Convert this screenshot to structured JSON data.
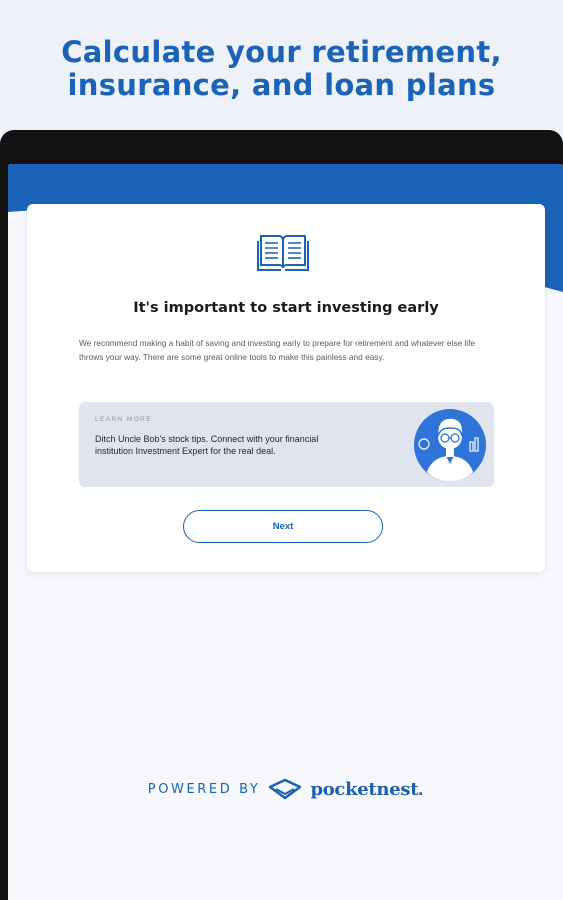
{
  "headline": {
    "line1": "Calculate your retirement,",
    "line2": "insurance, and loan plans"
  },
  "card": {
    "icon": "open-book-icon",
    "title": "It's important to start investing early",
    "body": "We recommend making a habit of saving and investing early to prepare for retirement and whatever else life throws your way.  There are some great online tools to make this painless and easy.",
    "learn_more": {
      "label": "LEARN MORE",
      "text": "Ditch Uncle Bob's stock tips. Connect with your financial institution Investment Expert for the real deal.",
      "illustration": "investment-expert-avatar"
    },
    "next_label": "Next"
  },
  "footer": {
    "powered_by": "POWERED BY",
    "brand": "pocketnest",
    "brand_dot": ".",
    "brand_icon": "pocketnest-logo-icon"
  },
  "colors": {
    "brand_blue": "#1a63b8",
    "page_bg": "#eef1f7",
    "device_frame": "#121212",
    "learn_box_bg": "#dfe4ee"
  }
}
